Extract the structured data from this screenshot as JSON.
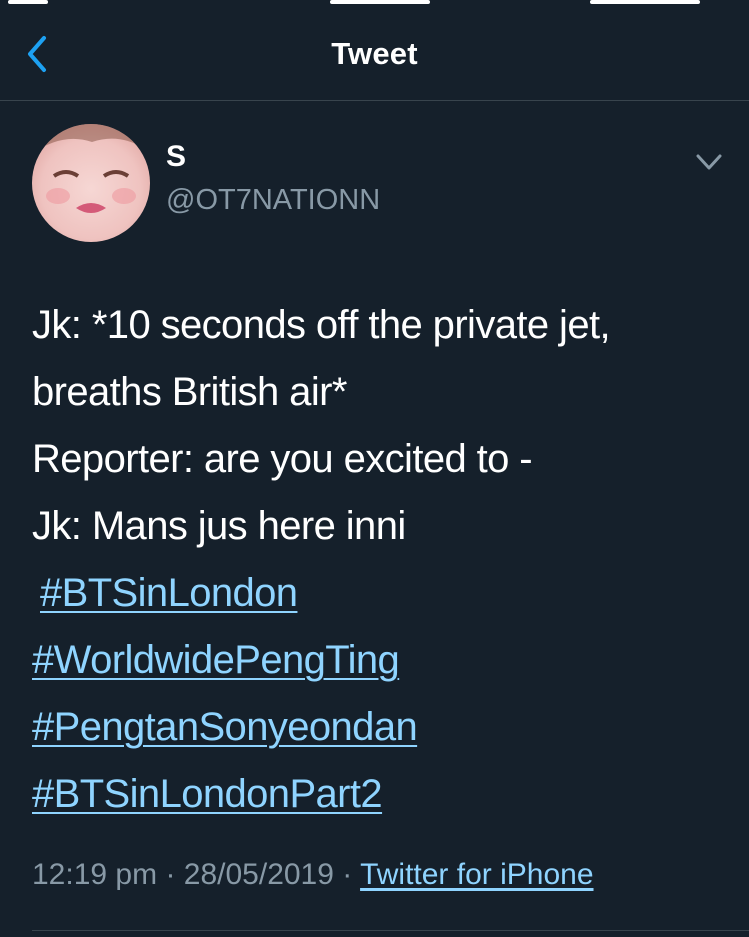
{
  "header": {
    "title": "Tweet",
    "back_icon": "chevron-left-icon"
  },
  "tweet": {
    "author": {
      "name": "S",
      "handle": "@OT7NATIONN"
    },
    "lines": [
      "Jk: *10 seconds off the private jet,",
      "breaths British air*",
      "Reporter: are you excited to -",
      "Jk: Mans jus here inni"
    ],
    "hashtags": [
      "#BTSinLondon",
      "#WorldwidePengTing",
      "#PengtanSonyeondan",
      "#BTSinLondonPart2"
    ],
    "time": "12:19 pm",
    "date": "28/05/2019",
    "separator": "·",
    "source": "Twitter for iPhone"
  },
  "colors": {
    "background": "#15202b",
    "link": "#8fd4ff",
    "muted": "#8899a6",
    "accent": "#1da1f2"
  }
}
